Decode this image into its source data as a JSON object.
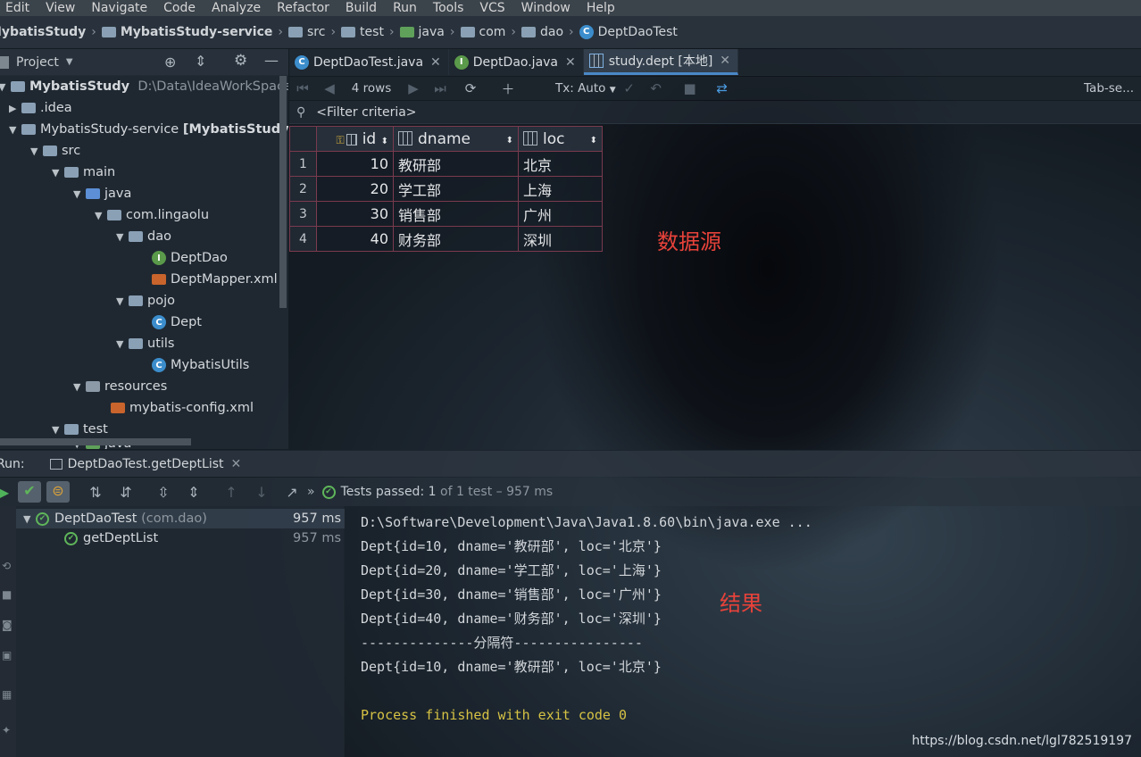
{
  "menu": [
    "Edit",
    "View",
    "Navigate",
    "Code",
    "Analyze",
    "Refactor",
    "Build",
    "Run",
    "Tools",
    "VCS",
    "Window",
    "Help"
  ],
  "breadcrumbs": [
    "MybatisStudy",
    "MybatisStudy-service",
    "src",
    "test",
    "java",
    "com",
    "dao",
    "DeptDaoTest"
  ],
  "project_panel": {
    "title": "Project",
    "dropdown": "▼"
  },
  "tree": {
    "root": "MybatisStudy",
    "root_path": "D:\\Data\\IdeaWorkSpaceStu",
    "idea": ".idea",
    "module": "MybatisStudy-service",
    "module_suffix": "[MybatisStudyser",
    "src": "src",
    "main": "main",
    "java": "java",
    "pkg": "com.lingaolu",
    "dao": "dao",
    "deptdao": "DeptDao",
    "deptmapper": "DeptMapper.xml",
    "pojo": "pojo",
    "dept": "Dept",
    "utils": "utils",
    "mybatisutils": "MybatisUtils",
    "resources": "resources",
    "config": "mybatis-config.xml",
    "test": "test",
    "test_java": "java"
  },
  "tabs": [
    {
      "label": "DeptDaoTest.java",
      "icon": "C"
    },
    {
      "label": "DeptDao.java",
      "icon": "I"
    },
    {
      "label": "study.dept [本地]",
      "icon": "table"
    }
  ],
  "db_toolbar": {
    "rows": "4 rows",
    "tx": "Tx: Auto",
    "tabsep": "Tab-se..."
  },
  "filter": {
    "label": "<Filter criteria>"
  },
  "table": {
    "columns": [
      "id",
      "dname",
      "loc"
    ],
    "rows": [
      {
        "n": "1",
        "id": "10",
        "dname": "教研部",
        "loc": "北京"
      },
      {
        "n": "2",
        "id": "20",
        "dname": "学工部",
        "loc": "上海"
      },
      {
        "n": "3",
        "id": "30",
        "dname": "销售部",
        "loc": "广州"
      },
      {
        "n": "4",
        "id": "40",
        "dname": "财务部",
        "loc": "深圳"
      }
    ]
  },
  "annotations": {
    "datasource": "数据源",
    "result": "结果"
  },
  "run": {
    "label": "Run:",
    "config": "DeptDaoTest.getDeptList"
  },
  "run_status": {
    "passed": "Tests passed:",
    "count": "1",
    "of": "of 1 test – 957 ms"
  },
  "test_tree": [
    {
      "name": "DeptDaoTest",
      "pkg": "(com.dao)",
      "time": "957 ms"
    },
    {
      "name": "getDeptList",
      "time": "957 ms"
    }
  ],
  "console": [
    "D:\\Software\\Development\\Java\\Java1.8.60\\bin\\java.exe ...",
    "Dept{id=10, dname='教研部', loc='北京'}",
    "Dept{id=20, dname='学工部', loc='上海'}",
    "Dept{id=30, dname='销售部', loc='广州'}",
    "Dept{id=40, dname='财务部', loc='深圳'}",
    "--------------分隔符----------------",
    "Dept{id=10, dname='教研部', loc='北京'}"
  ],
  "console_exit": "Process finished with exit code 0",
  "watermark": "https://blog.csdn.net/lgl782519197",
  "colors": {
    "accent": "#4a88c7",
    "pass": "#5fb65a",
    "annotation": "#e8423a",
    "exit": "#d6c244"
  }
}
